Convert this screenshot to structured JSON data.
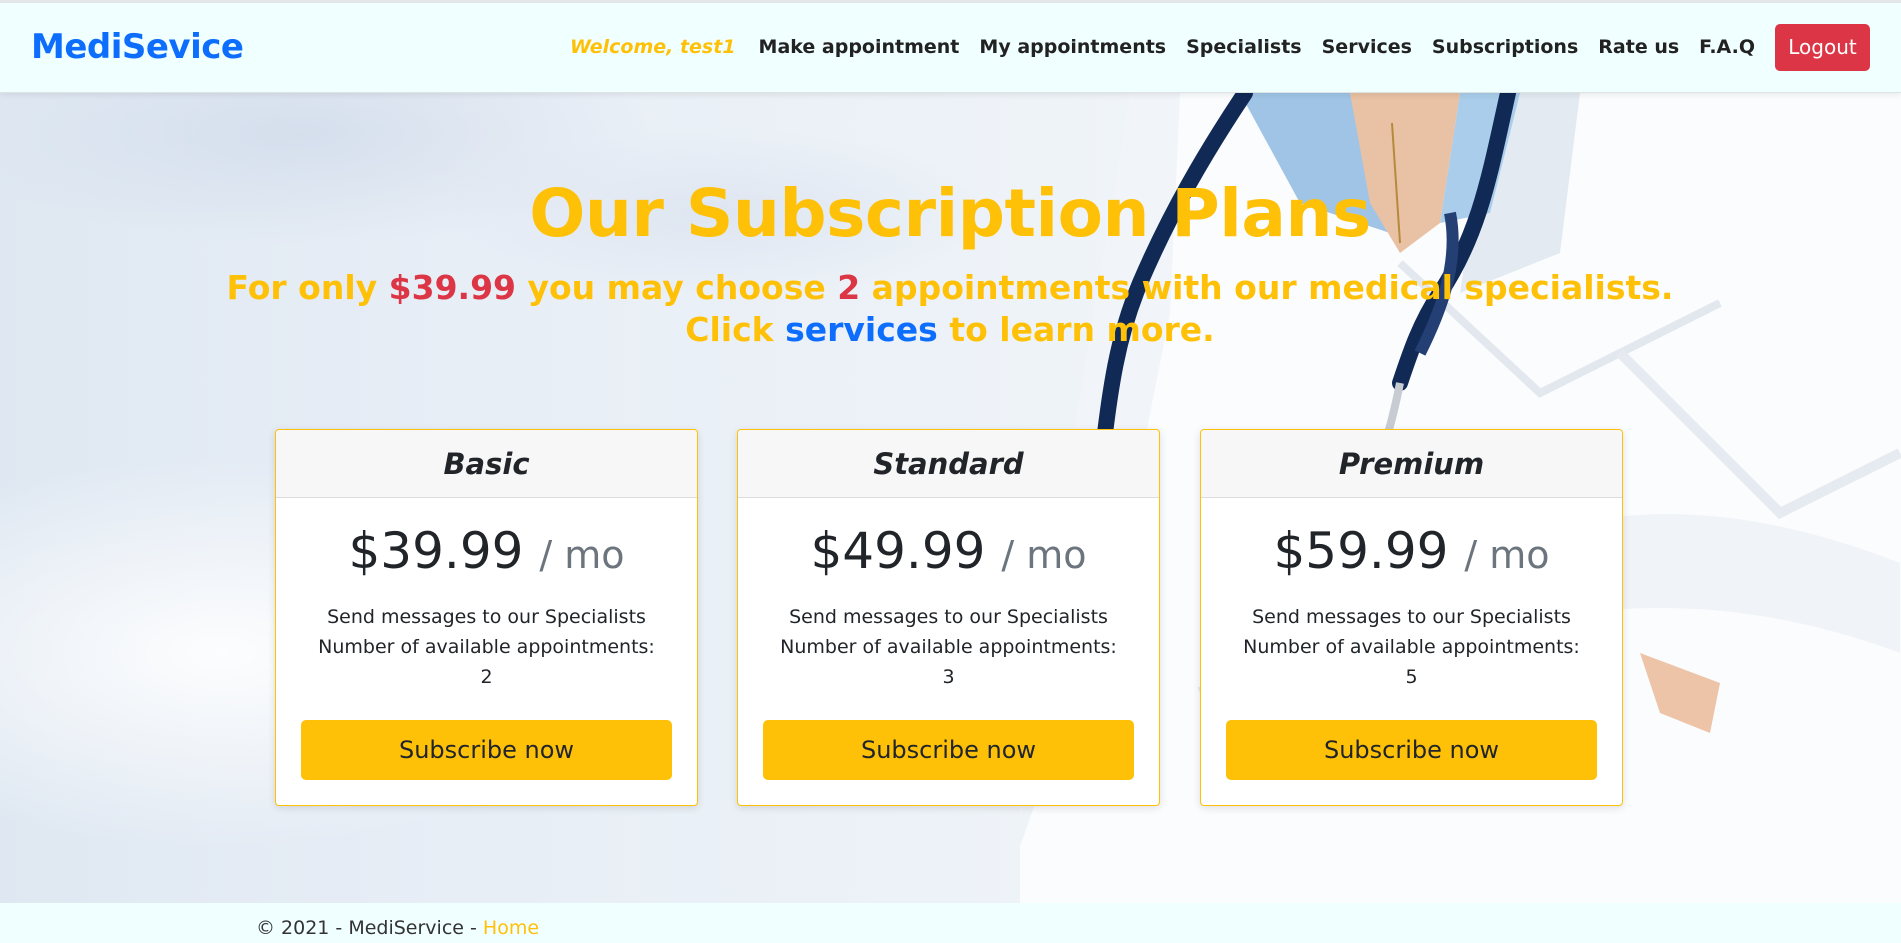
{
  "brand": "MediSevice",
  "nav": {
    "welcome": "Welcome, test1",
    "items": [
      "Make appointment",
      "My appointments",
      "Specialists",
      "Services",
      "Subscriptions",
      "Rate us",
      "F.A.Q"
    ],
    "logout": "Logout"
  },
  "hero": {
    "title": "Our Subscription Plans",
    "line1_a": "For only ",
    "line1_price": "$39.99",
    "line1_b": " you may choose ",
    "line1_count": "2",
    "line1_c": " appointments with our medical specialists.",
    "line2_a": "Click ",
    "line2_link": "services",
    "line2_b": " to learn more."
  },
  "plans": [
    {
      "name": "Basic",
      "price": "$39.99",
      "per": "/ mo",
      "feature1": "Send messages to our Specialists",
      "feature2": "Number of available appointments: 2",
      "button": "Subscribe now"
    },
    {
      "name": "Standard",
      "price": "$49.99",
      "per": "/ mo",
      "feature1": "Send messages to our Specialists",
      "feature2": "Number of available appointments: 3",
      "button": "Subscribe now"
    },
    {
      "name": "Premium",
      "price": "$59.99",
      "per": "/ mo",
      "feature1": "Send messages to our Specialists",
      "feature2": "Number of available appointments: 5",
      "button": "Subscribe now"
    }
  ],
  "footer": {
    "text": "© 2021 - MediService - ",
    "link": "Home"
  },
  "colors": {
    "accent": "#ffc107",
    "brand": "#0d6efd",
    "danger": "#dc3545"
  }
}
